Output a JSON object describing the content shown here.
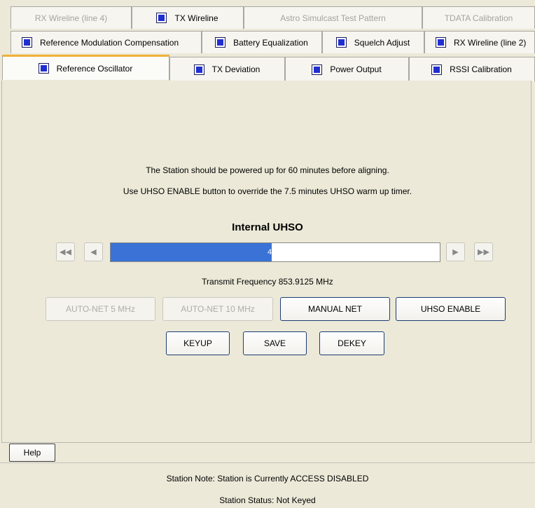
{
  "tabs": {
    "row1": [
      {
        "label": "RX Wireline (line 4)",
        "icon": "",
        "disabled": true
      },
      {
        "label": "TX Wireline",
        "icon": "blue-square-icon",
        "disabled": false
      },
      {
        "label": "Astro Simulcast Test Pattern",
        "icon": "",
        "disabled": true
      },
      {
        "label": "TDATA Calibration",
        "icon": "",
        "disabled": true
      }
    ],
    "row2": [
      {
        "label": "Reference Modulation Compensation",
        "icon": "blue-square-icon"
      },
      {
        "label": "Battery Equalization",
        "icon": "blue-square-icon"
      },
      {
        "label": "Squelch Adjust",
        "icon": "blue-square-icon"
      },
      {
        "label": "RX Wireline (line 2)",
        "icon": "blue-square-icon"
      }
    ],
    "row3": [
      {
        "label": "Reference Oscillator",
        "icon": "blue-square-icon",
        "active": true
      },
      {
        "label": "TX Deviation",
        "icon": "blue-square-icon"
      },
      {
        "label": "Power Output",
        "icon": "blue-square-icon"
      },
      {
        "label": "RSSI Calibration",
        "icon": "blue-square-icon"
      }
    ]
  },
  "main": {
    "instruction1": "The Station should be powered up for 60 minutes before aligning.",
    "instruction2": "Use UHSO ENABLE button to override the 7.5 minutes UHSO warm up timer.",
    "section_title": "Internal UHSO",
    "progress": {
      "value": 0.49,
      "label": "49%"
    },
    "frequency": "Transmit Frequency  853.9125  MHz",
    "buttons": {
      "auto_net_5": "AUTO-NET 5 MHz",
      "auto_net_10": "AUTO-NET 10 MHz",
      "manual_net": "MANUAL NET",
      "uhso_enable": "UHSO ENABLE",
      "keyup": "KEYUP",
      "save": "SAVE",
      "dekey": "DEKEY"
    }
  },
  "footer": {
    "help": "Help",
    "station_note": "Station Note:  Station is Currently ACCESS DISABLED",
    "station_status": "Station Status:  Not Keyed"
  },
  "colors": {
    "accent": "#3a72d6",
    "tab_icon": "#1f2fd0",
    "active_tab_top": "#f0b038"
  }
}
